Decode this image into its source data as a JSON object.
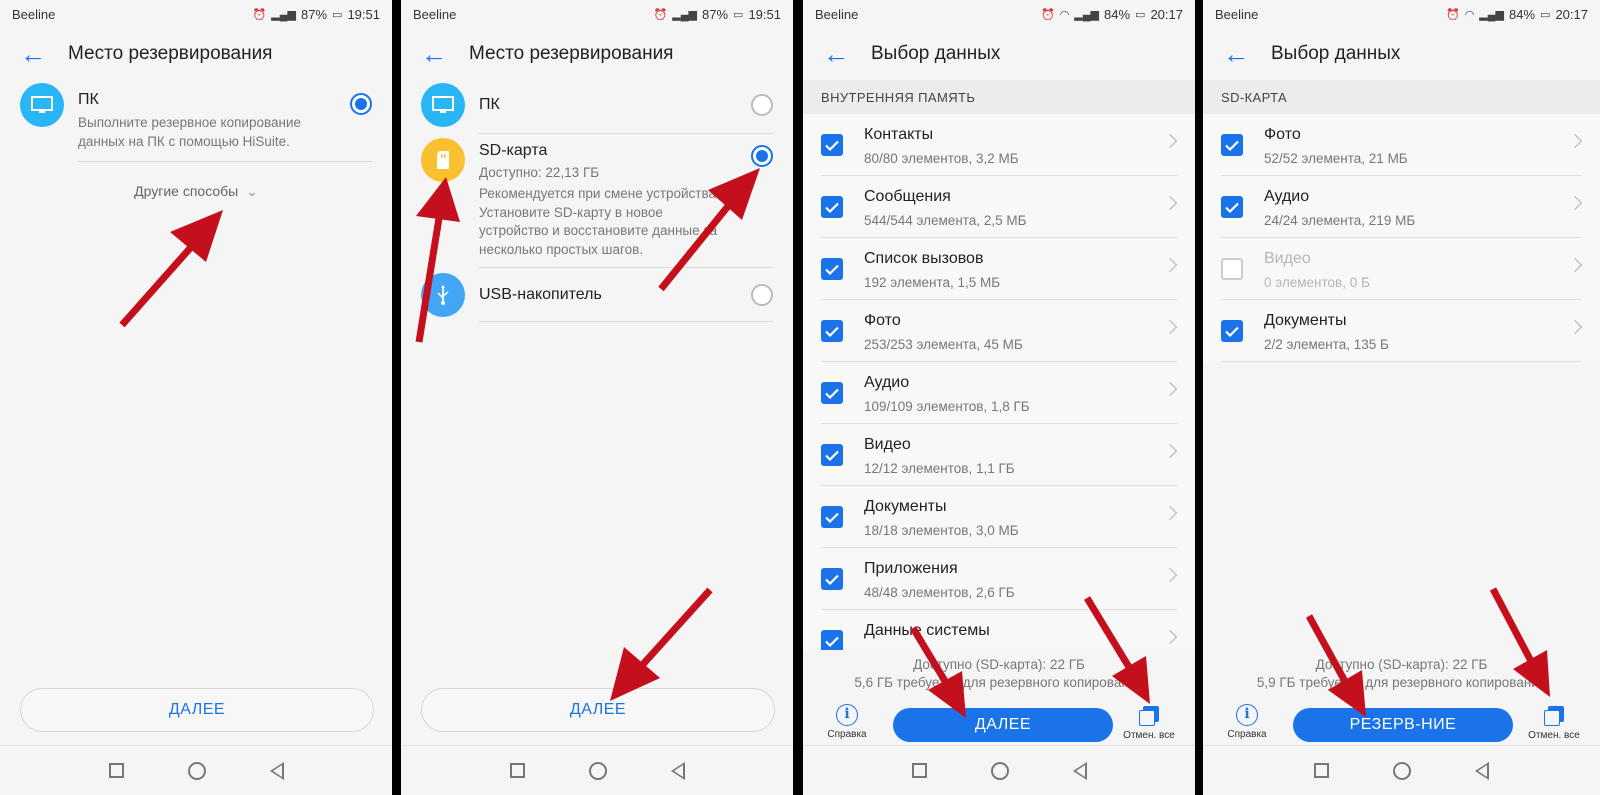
{
  "status": {
    "s1": {
      "carrier": "Beeline",
      "battery": "87%",
      "time": "19:51"
    },
    "s2": {
      "carrier": "Beeline",
      "battery": "87%",
      "time": "19:51"
    },
    "s3": {
      "carrier": "Beeline",
      "battery": "84%",
      "time": "20:17"
    },
    "s4": {
      "carrier": "Beeline",
      "battery": "84%",
      "time": "20:17"
    }
  },
  "screen1": {
    "title": "Место резервирования",
    "pc_name": "ПК",
    "pc_desc": "Выполните резервное копирование данных на ПК с помощью HiSuite.",
    "other_methods": "Другие способы",
    "next": "ДАЛЕЕ"
  },
  "screen2": {
    "title": "Место резервирования",
    "pc_name": "ПК",
    "sd_name": "SD-карта",
    "sd_available": "Доступно: 22,13 ГБ",
    "sd_desc": "Рекомендуется при смене устройства. Установите SD-карту в новое устройство и восстановите данные за несколько простых шагов.",
    "usb_name": "USB-накопитель",
    "next": "ДАЛЕЕ"
  },
  "screen3": {
    "title": "Выбор данных",
    "section": "ВНУТРЕННЯЯ ПАМЯТЬ",
    "items": [
      {
        "name": "Контакты",
        "sub": "80/80 элементов, 3,2 МБ",
        "checked": true
      },
      {
        "name": "Сообщения",
        "sub": "544/544 элемента, 2,5 МБ",
        "checked": true
      },
      {
        "name": "Список вызовов",
        "sub": "192 элемента, 1,5 МБ",
        "checked": true
      },
      {
        "name": "Фото",
        "sub": "253/253 элемента, 45 МБ",
        "checked": true
      },
      {
        "name": "Аудио",
        "sub": "109/109 элементов, 1,8 ГБ",
        "checked": true
      },
      {
        "name": "Видео",
        "sub": "12/12 элементов, 1,1 ГБ",
        "checked": true
      },
      {
        "name": "Документы",
        "sub": "18/18 элементов, 3,0 МБ",
        "checked": true
      },
      {
        "name": "Приложения",
        "sub": "48/48 элементов, 2,6 ГБ",
        "checked": true
      },
      {
        "name": "Данные системы",
        "sub": "",
        "checked": true
      }
    ],
    "available": "Доступно (SD-карта): 22 ГБ",
    "required": "5,6 ГБ требуется для резервного копирования",
    "help": "Справка",
    "action": "ДАЛЕЕ",
    "cancel_all": "Отмен. все"
  },
  "screen4": {
    "title": "Выбор данных",
    "section": "SD-КАРТА",
    "items": [
      {
        "name": "Фото",
        "sub": "52/52 элемента, 21 МБ",
        "checked": true
      },
      {
        "name": "Аудио",
        "sub": "24/24 элемента, 219 МБ",
        "checked": true
      },
      {
        "name": "Видео",
        "sub": "0 элементов, 0 Б",
        "checked": false
      },
      {
        "name": "Документы",
        "sub": "2/2 элемента, 135 Б",
        "checked": true
      }
    ],
    "available": "Доступно (SD-карта): 22 ГБ",
    "required": "5,9 ГБ требуется для резервного копирования",
    "help": "Справка",
    "action": "РЕЗЕРВ-НИЕ",
    "cancel_all": "Отмен. все"
  },
  "colors": {
    "accent": "#1a73e8",
    "arrow": "#c4101c",
    "pc_circle": "#29b6f6",
    "sd_circle": "#fbc02d",
    "usb_circle": "#42a5f5"
  }
}
